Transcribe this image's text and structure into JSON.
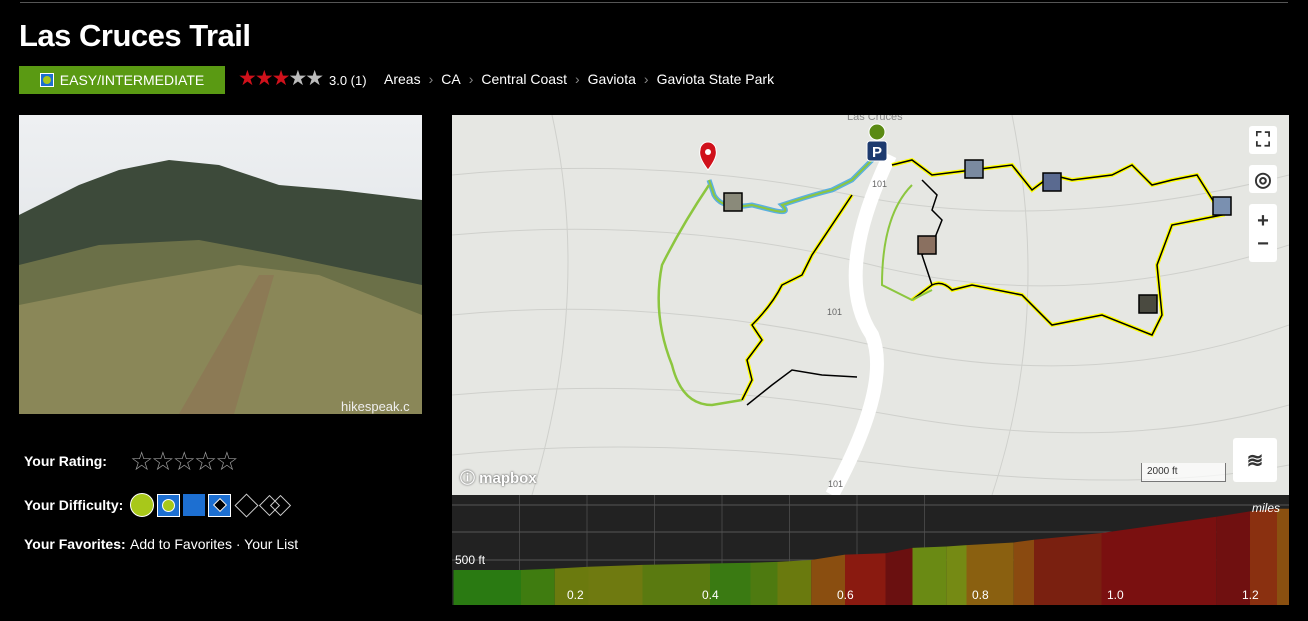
{
  "title": "Las Cruces Trail",
  "difficulty": {
    "label": "EASY/INTERMEDIATE",
    "color": "#5a9a13"
  },
  "rating": {
    "stars_filled": 3,
    "stars_total": 5,
    "text": "3.0 (1)",
    "star_color": "#d0111b"
  },
  "breadcrumbs": [
    "Areas",
    "CA",
    "Central Coast",
    "Gaviota",
    "Gaviota State Park"
  ],
  "photo": {
    "watermark": "hikespeak.c"
  },
  "user": {
    "rating_label": "Your Rating:",
    "difficulty_label": "Your Difficulty:",
    "favorites_label": "Your Favorites:",
    "add_favorites": "Add to Favorites",
    "separator": "·",
    "your_list": "Your List"
  },
  "map": {
    "place_label": "Las Cruces",
    "road_labels": [
      "101",
      "101",
      "101"
    ],
    "logo": "mapbox",
    "scale": "2000 ft",
    "controls": [
      "fullscreen-icon",
      "locate-icon",
      "zoom-in",
      "zoom-out",
      "layers-icon"
    ]
  },
  "elevation": {
    "y_label": "500 ft",
    "x_unit": "miles",
    "x_ticks": [
      "0.2",
      "0.4",
      "0.6",
      "0.8",
      "1.0",
      "1.2"
    ],
    "segments": [
      [
        0.02,
        463,
        "#2a7a12"
      ],
      [
        0.12,
        463,
        "#3f7c10"
      ],
      [
        0.17,
        468,
        "#6b7a0e"
      ],
      [
        0.22,
        475,
        "#6f7a10"
      ],
      [
        0.3,
        482,
        "#5a7a10"
      ],
      [
        0.4,
        487,
        "#3a7a12"
      ],
      [
        0.46,
        490,
        "#4e7a10"
      ],
      [
        0.5,
        493,
        "#6a7a0e"
      ],
      [
        0.55,
        500,
        "#8a4e10"
      ],
      [
        0.6,
        520,
        "#8a1a10"
      ],
      [
        0.66,
        525,
        "#6a1010"
      ],
      [
        0.7,
        545,
        "#6a8a14"
      ],
      [
        0.75,
        550,
        "#758a14"
      ],
      [
        0.78,
        555,
        "#8a6010"
      ],
      [
        0.85,
        565,
        "#8a4a10"
      ],
      [
        0.88,
        575,
        "#7a2010"
      ],
      [
        0.98,
        600,
        "#7a1010"
      ],
      [
        1.15,
        660,
        "#701010"
      ],
      [
        1.2,
        680,
        "#8a3010"
      ],
      [
        1.24,
        690,
        "#8a5010"
      ]
    ]
  }
}
